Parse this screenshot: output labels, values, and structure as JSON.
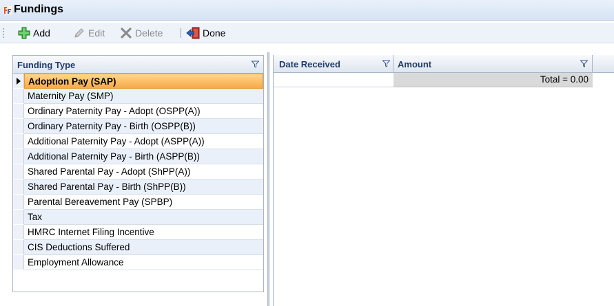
{
  "window": {
    "title": "Fundings"
  },
  "toolbar": {
    "add_label": "Add",
    "edit_label": "Edit",
    "delete_label": "Delete",
    "done_label": "Done"
  },
  "funding_grid": {
    "header": "Funding Type",
    "selected_index": 0,
    "rows": [
      "Adoption Pay (SAP)",
      "Maternity Pay (SMP)",
      "Ordinary Paternity Pay - Adopt (OSPP(A))",
      "Ordinary Paternity Pay - Birth (OSPP(B))",
      "Additional Paternity Pay - Adopt (ASPP(A))",
      "Additional Paternity Pay - Birth (ASPP(B))",
      "Shared Parental Pay - Adopt (ShPP(A))",
      "Shared Parental Pay - Birth (ShPP(B))",
      "Parental Bereavement Pay (SPBP)",
      "Tax",
      "HMRC Internet Filing Incentive",
      "CIS Deductions Suffered",
      "Employment Allowance"
    ]
  },
  "detail_grid": {
    "headers": {
      "date_received": "Date Received",
      "amount": "Amount"
    },
    "total_text": "Total = 0.00"
  },
  "colors": {
    "selected_row": "#f8a94a",
    "alt_row": "#e9f0fa",
    "header_text": "#1f3b6b"
  }
}
